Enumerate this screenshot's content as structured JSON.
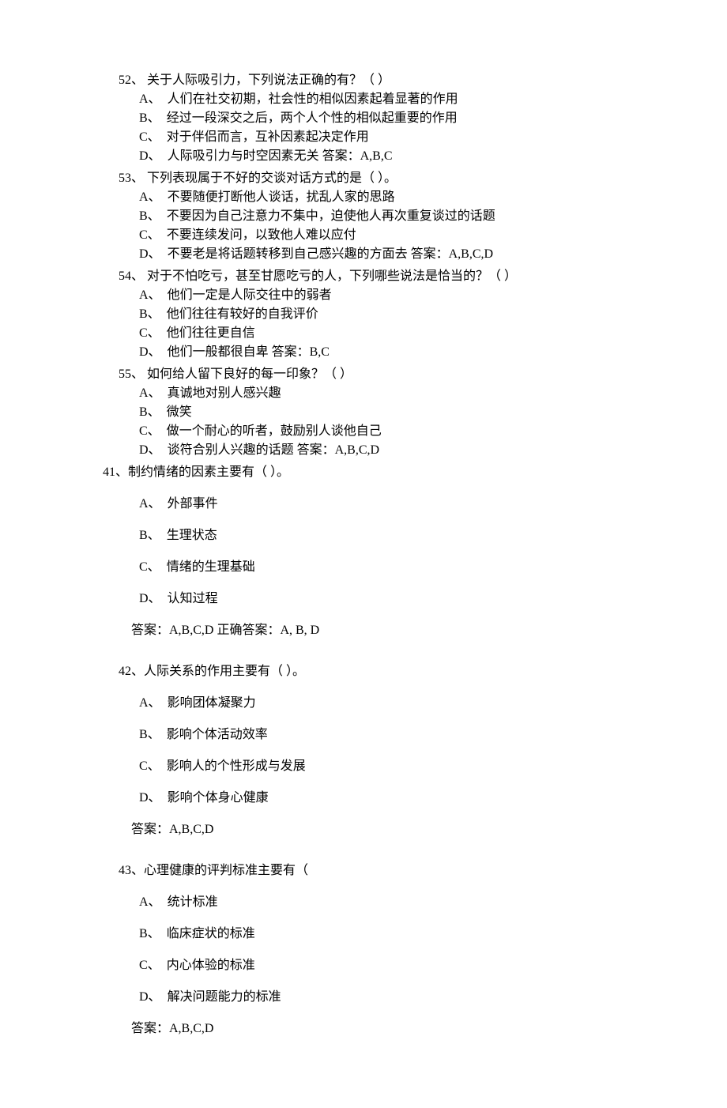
{
  "questions_tight": [
    {
      "num": "52、",
      "stem": "关于人际吸引力，下列说法正确的有？（   ）",
      "opts": [
        {
          "label": "A、",
          "text": "人们在社交初期，社会性的相似因素起着显著的作用"
        },
        {
          "label": "B、",
          "text": "经过一段深交之后，两个人个性的相似起重要的作用"
        },
        {
          "label": "C、",
          "text": "对于伴侣而言，互补因素起决定作用"
        },
        {
          "label": "D、",
          "text": "人际吸引力与时空因素无关",
          "ans": "答案：A,B,C"
        }
      ]
    },
    {
      "num": "53、",
      "stem": "下列表现属于不好的交谈对话方式的是（   ）。",
      "opts": [
        {
          "label": "A、",
          "text": "不要随便打断他人谈话，扰乱人家的思路"
        },
        {
          "label": "B、",
          "text": "不要因为自己注意力不集中，迫使他人再次重复谈过的话题"
        },
        {
          "label": "C、",
          "text": "不要连续发问，以致他人难以应付"
        },
        {
          "label": "D、",
          "text": "不要老是将话题转移到自己感兴趣的方面去",
          "ans": "答案：A,B,C,D"
        }
      ]
    },
    {
      "num": "54、",
      "stem": "对于不怕吃亏，甚至甘愿吃亏的人，下列哪些说法是恰当的？（   ）",
      "opts": [
        {
          "label": "A、",
          "text": "他们一定是人际交往中的弱者"
        },
        {
          "label": "B、",
          "text": "他们往往有较好的自我评价"
        },
        {
          "label": "C、",
          "text": "他们往往更自信"
        },
        {
          "label": "D、",
          "text": "他们一般都很自卑",
          "ans": "答案：B,C"
        }
      ]
    },
    {
      "num": "55、",
      "stem": "如何给人留下良好的每一印象？（   ）",
      "opts": [
        {
          "label": "A、",
          "text": "真诚地对别人感兴趣"
        },
        {
          "label": "B、",
          "text": "微笑"
        },
        {
          "label": "C、",
          "text": "做一个耐心的听者，鼓励别人谈他自己"
        },
        {
          "label": "D、",
          "text": "谈符合别人兴趣的话题",
          "ans": "答案：A,B,C,D"
        }
      ]
    }
  ],
  "q41": {
    "num": "41、",
    "stem": "制约情绪的因素主要有（  ）。",
    "opts": [
      {
        "label": "A、",
        "text": "外部事件"
      },
      {
        "label": "B、",
        "text": "生理状态"
      },
      {
        "label": "C、",
        "text": "情绪的生理基础"
      },
      {
        "label": "D、",
        "text": "认知过程"
      }
    ],
    "ans": "答案：A,B,C,D 正确答案：A, B, D"
  },
  "questions_spaced": [
    {
      "num": "42、",
      "stem": "人际关系的作用主要有（  ）。",
      "opts": [
        {
          "label": "A、",
          "text": "影响团体凝聚力"
        },
        {
          "label": "B、",
          "text": "影响个体活动效率"
        },
        {
          "label": "C、",
          "text": "影响人的个性形成与发展"
        },
        {
          "label": "D、",
          "text": "影响个体身心健康"
        }
      ],
      "ans": "答案：A,B,C,D"
    },
    {
      "num": "43、",
      "stem": "心理健康的评判标准主要有（",
      "opts": [
        {
          "label": "A、",
          "text": "统计标准"
        },
        {
          "label": "B、",
          "text": "临床症状的标准"
        },
        {
          "label": "C、",
          "text": "内心体验的标准"
        },
        {
          "label": "D、",
          "text": "解决问题能力的标准"
        }
      ],
      "ans": "答案：A,B,C,D"
    }
  ]
}
